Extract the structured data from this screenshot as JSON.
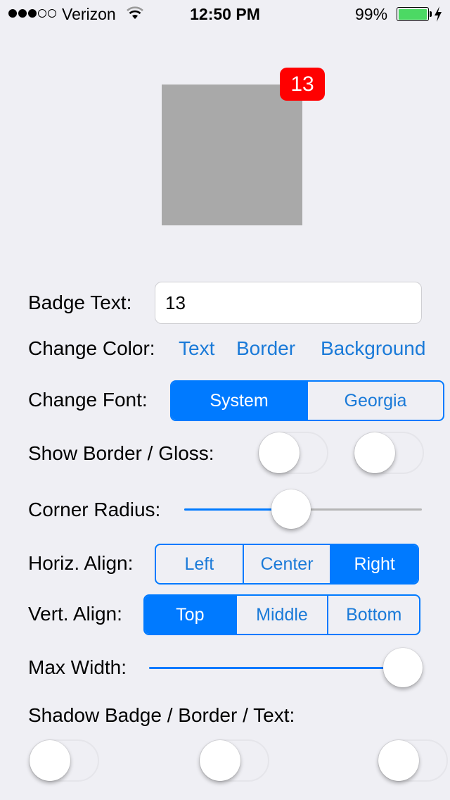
{
  "status_bar": {
    "signal_bars_filled": 3,
    "signal_bars_total": 5,
    "carrier": "Verizon",
    "time": "12:50 PM",
    "battery_percent_label": "99%",
    "battery_level": 0.99,
    "charging": true,
    "icons": [
      "signal-dots-icon",
      "wifi-icon",
      "battery-icon",
      "charging-bolt-icon"
    ]
  },
  "preview": {
    "badge_text": "13",
    "badge_color": "#ff0000",
    "box_color": "#a9a9a9"
  },
  "form": {
    "badge_text_label": "Badge Text:",
    "badge_text_value": "13",
    "change_color_label": "Change Color:",
    "color_links": [
      "Text",
      "Border",
      "Background"
    ],
    "change_font_label": "Change Font:",
    "font_options": [
      "System",
      "Georgia"
    ],
    "font_selected": "System",
    "border_gloss_label": "Show Border / Gloss:",
    "show_border": false,
    "show_gloss": false,
    "corner_radius_label": "Corner Radius:",
    "corner_radius_value": 0.44,
    "horiz_align_label": "Horiz. Align:",
    "horiz_align_options": [
      "Left",
      "Center",
      "Right"
    ],
    "horiz_align_selected": "Right",
    "vert_align_label": "Vert. Align:",
    "vert_align_options": [
      "Top",
      "Middle",
      "Bottom"
    ],
    "vert_align_selected": "Top",
    "max_width_label": "Max Width:",
    "max_width_value": 1.0,
    "shadow_label": "Shadow Badge / Border / Text:",
    "shadow_badge": false,
    "shadow_border": false,
    "shadow_text": false
  },
  "colors": {
    "accent": "#007aff",
    "link": "#1a7ad8",
    "background": "#efeff4",
    "battery_green": "#4cd964"
  }
}
